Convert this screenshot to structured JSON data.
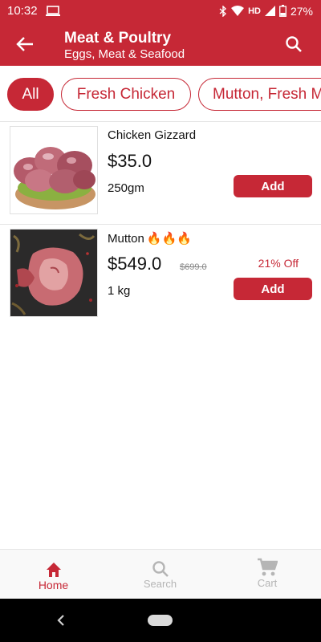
{
  "status": {
    "time": "10:32",
    "network": "HD",
    "battery": "27%"
  },
  "header": {
    "title": "Meat & Poultry",
    "subtitle": "Eggs, Meat & Seafood"
  },
  "categories": [
    "All",
    "Fresh Chicken",
    "Mutton, Fresh M"
  ],
  "products": [
    {
      "name": "Chicken Gizzard",
      "price": "$35.0",
      "quantity": "250gm",
      "add_label": "Add"
    },
    {
      "name": "Mutton",
      "emoji": "🔥🔥🔥",
      "price": "$549.0",
      "mrp": "$699.0",
      "discount": "21% Off",
      "quantity": "1 kg",
      "add_label": "Add"
    }
  ],
  "nav": [
    {
      "label": "Home",
      "icon": "home-icon"
    },
    {
      "label": "Search",
      "icon": "search-icon"
    },
    {
      "label": "Cart",
      "icon": "cart-icon"
    }
  ],
  "colors": {
    "primary": "#c62836",
    "inactive": "#b5b5b5"
  }
}
